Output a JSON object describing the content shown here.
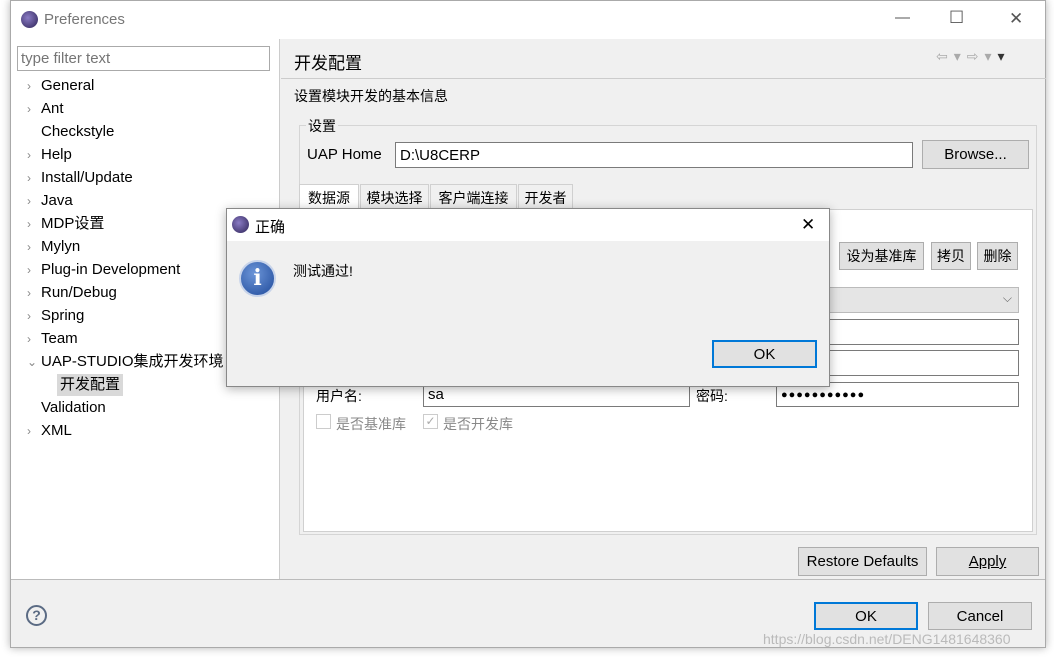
{
  "window": {
    "title": "Preferences",
    "minimize": "—",
    "maximize": "☐",
    "close": "✕"
  },
  "filter": {
    "placeholder": "type filter text"
  },
  "tree": [
    {
      "label": "General",
      "arrow": "›"
    },
    {
      "label": "Ant",
      "arrow": "›"
    },
    {
      "label": "Checkstyle",
      "arrow": ""
    },
    {
      "label": "Help",
      "arrow": "›"
    },
    {
      "label": "Install/Update",
      "arrow": "›"
    },
    {
      "label": "Java",
      "arrow": "›"
    },
    {
      "label": "MDP设置",
      "arrow": "›"
    },
    {
      "label": "Mylyn",
      "arrow": "›"
    },
    {
      "label": "Plug-in Development",
      "arrow": "›"
    },
    {
      "label": "Run/Debug",
      "arrow": "›"
    },
    {
      "label": "Spring",
      "arrow": "›"
    },
    {
      "label": "Team",
      "arrow": "›"
    },
    {
      "label": "UAP-STUDIO集成开发环境",
      "arrow": "⌄"
    },
    {
      "label": "开发配置",
      "arrow": "",
      "child": true,
      "selected": true
    },
    {
      "label": "Validation",
      "arrow": ""
    },
    {
      "label": "XML",
      "arrow": "›"
    }
  ],
  "page": {
    "title": "开发配置",
    "description": "设置模块开发的基本信息",
    "group_label": "设置",
    "uap_home_label": "UAP Home",
    "uap_home_value": "D:\\U8CERP",
    "browse": "Browse...",
    "tabs": [
      "数据源",
      "模块选择",
      "客户端连接",
      "开发者"
    ],
    "buttons": {
      "set_base": "设为基准库",
      "copy": "拷贝",
      "delete": "删除"
    },
    "username_label": "用户名:",
    "username_value": "sa",
    "password_label": "密码:",
    "password_value": "●●●●●●●●●●●",
    "checkbox_base": {
      "label": "是否基准库",
      "checked": false
    },
    "checkbox_dev": {
      "label": "是否开发库",
      "checked": true
    },
    "restore": "Restore Defaults",
    "apply": "Apply"
  },
  "footer": {
    "ok": "OK",
    "cancel": "Cancel",
    "help": "?"
  },
  "dialog": {
    "title": "正确",
    "message": "测试通过!",
    "ok": "OK",
    "close": "✕",
    "icon": "info-icon"
  },
  "watermark": "https://blog.csdn.net/DENG1481648360",
  "colors": {
    "accent": "#0078d7",
    "info": "#2a5aa8"
  }
}
